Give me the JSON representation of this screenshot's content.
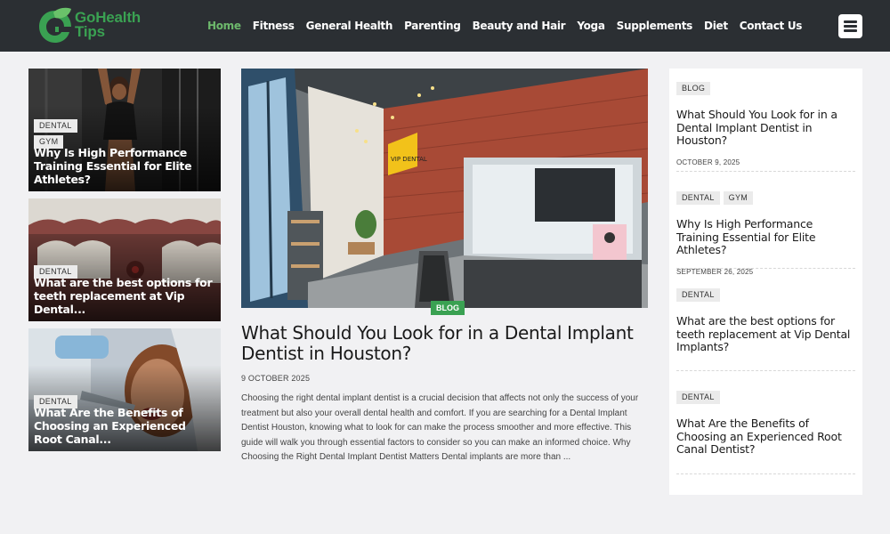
{
  "site": {
    "logo_line1": "GoHealth",
    "logo_line2": "Tips",
    "brand_color": "#3aa152",
    "header_bg": "#2b2f33"
  },
  "nav": {
    "items": [
      "Home",
      "Fitness",
      "General Health",
      "Parenting",
      "Beauty and Hair",
      "Yoga",
      "Supplements",
      "Diet",
      "Contact Us"
    ],
    "active": "Home",
    "menu_icon": "hamburger-icon"
  },
  "left_cards": [
    {
      "tags": [
        "DENTAL",
        "GYM"
      ],
      "title": "Why Is High Performance Training Essential for Elite Athletes?"
    },
    {
      "tags": [
        "DENTAL"
      ],
      "title": "What are the best options for teeth replacement at Vip Dental..."
    },
    {
      "tags": [
        "DENTAL"
      ],
      "title": "What Are the Benefits of Choosing an Experienced Root Canal..."
    }
  ],
  "featured": {
    "badge": "BLOG",
    "sign_text": "VIP DENTAL",
    "title": "What Should You Look for in a Dental Implant Dentist in Houston?",
    "date": "9 OCTOBER 2025",
    "excerpt": "Choosing the right dental implant dentist is a crucial decision that affects not only the success of your treatment but also your overall dental health and comfort. If you are searching for a Dental Implant Dentist Houston, knowing what to look for can make the process smoother and more effective. This guide will walk you through essential factors to consider so you can make an informed choice. Why Choosing the Right Dental Implant Dentist Matters Dental implants are more than ..."
  },
  "sidebar": [
    {
      "tags": [
        "BLOG"
      ],
      "title": "What Should You Look for in a Dental Implant Dentist in Houston?",
      "date": "OCTOBER 9, 2025"
    },
    {
      "tags": [
        "DENTAL",
        "GYM"
      ],
      "title": "Why Is High Performance Training Essential for Elite Athletes?",
      "date": "SEPTEMBER 26, 2025"
    },
    {
      "tags": [
        "DENTAL"
      ],
      "title": "What are the best options for teeth replacement at Vip Dental Implants?",
      "date": ""
    },
    {
      "tags": [
        "DENTAL"
      ],
      "title": "What Are the Benefits of Choosing an Experienced Root Canal Dentist?",
      "date": ""
    }
  ]
}
